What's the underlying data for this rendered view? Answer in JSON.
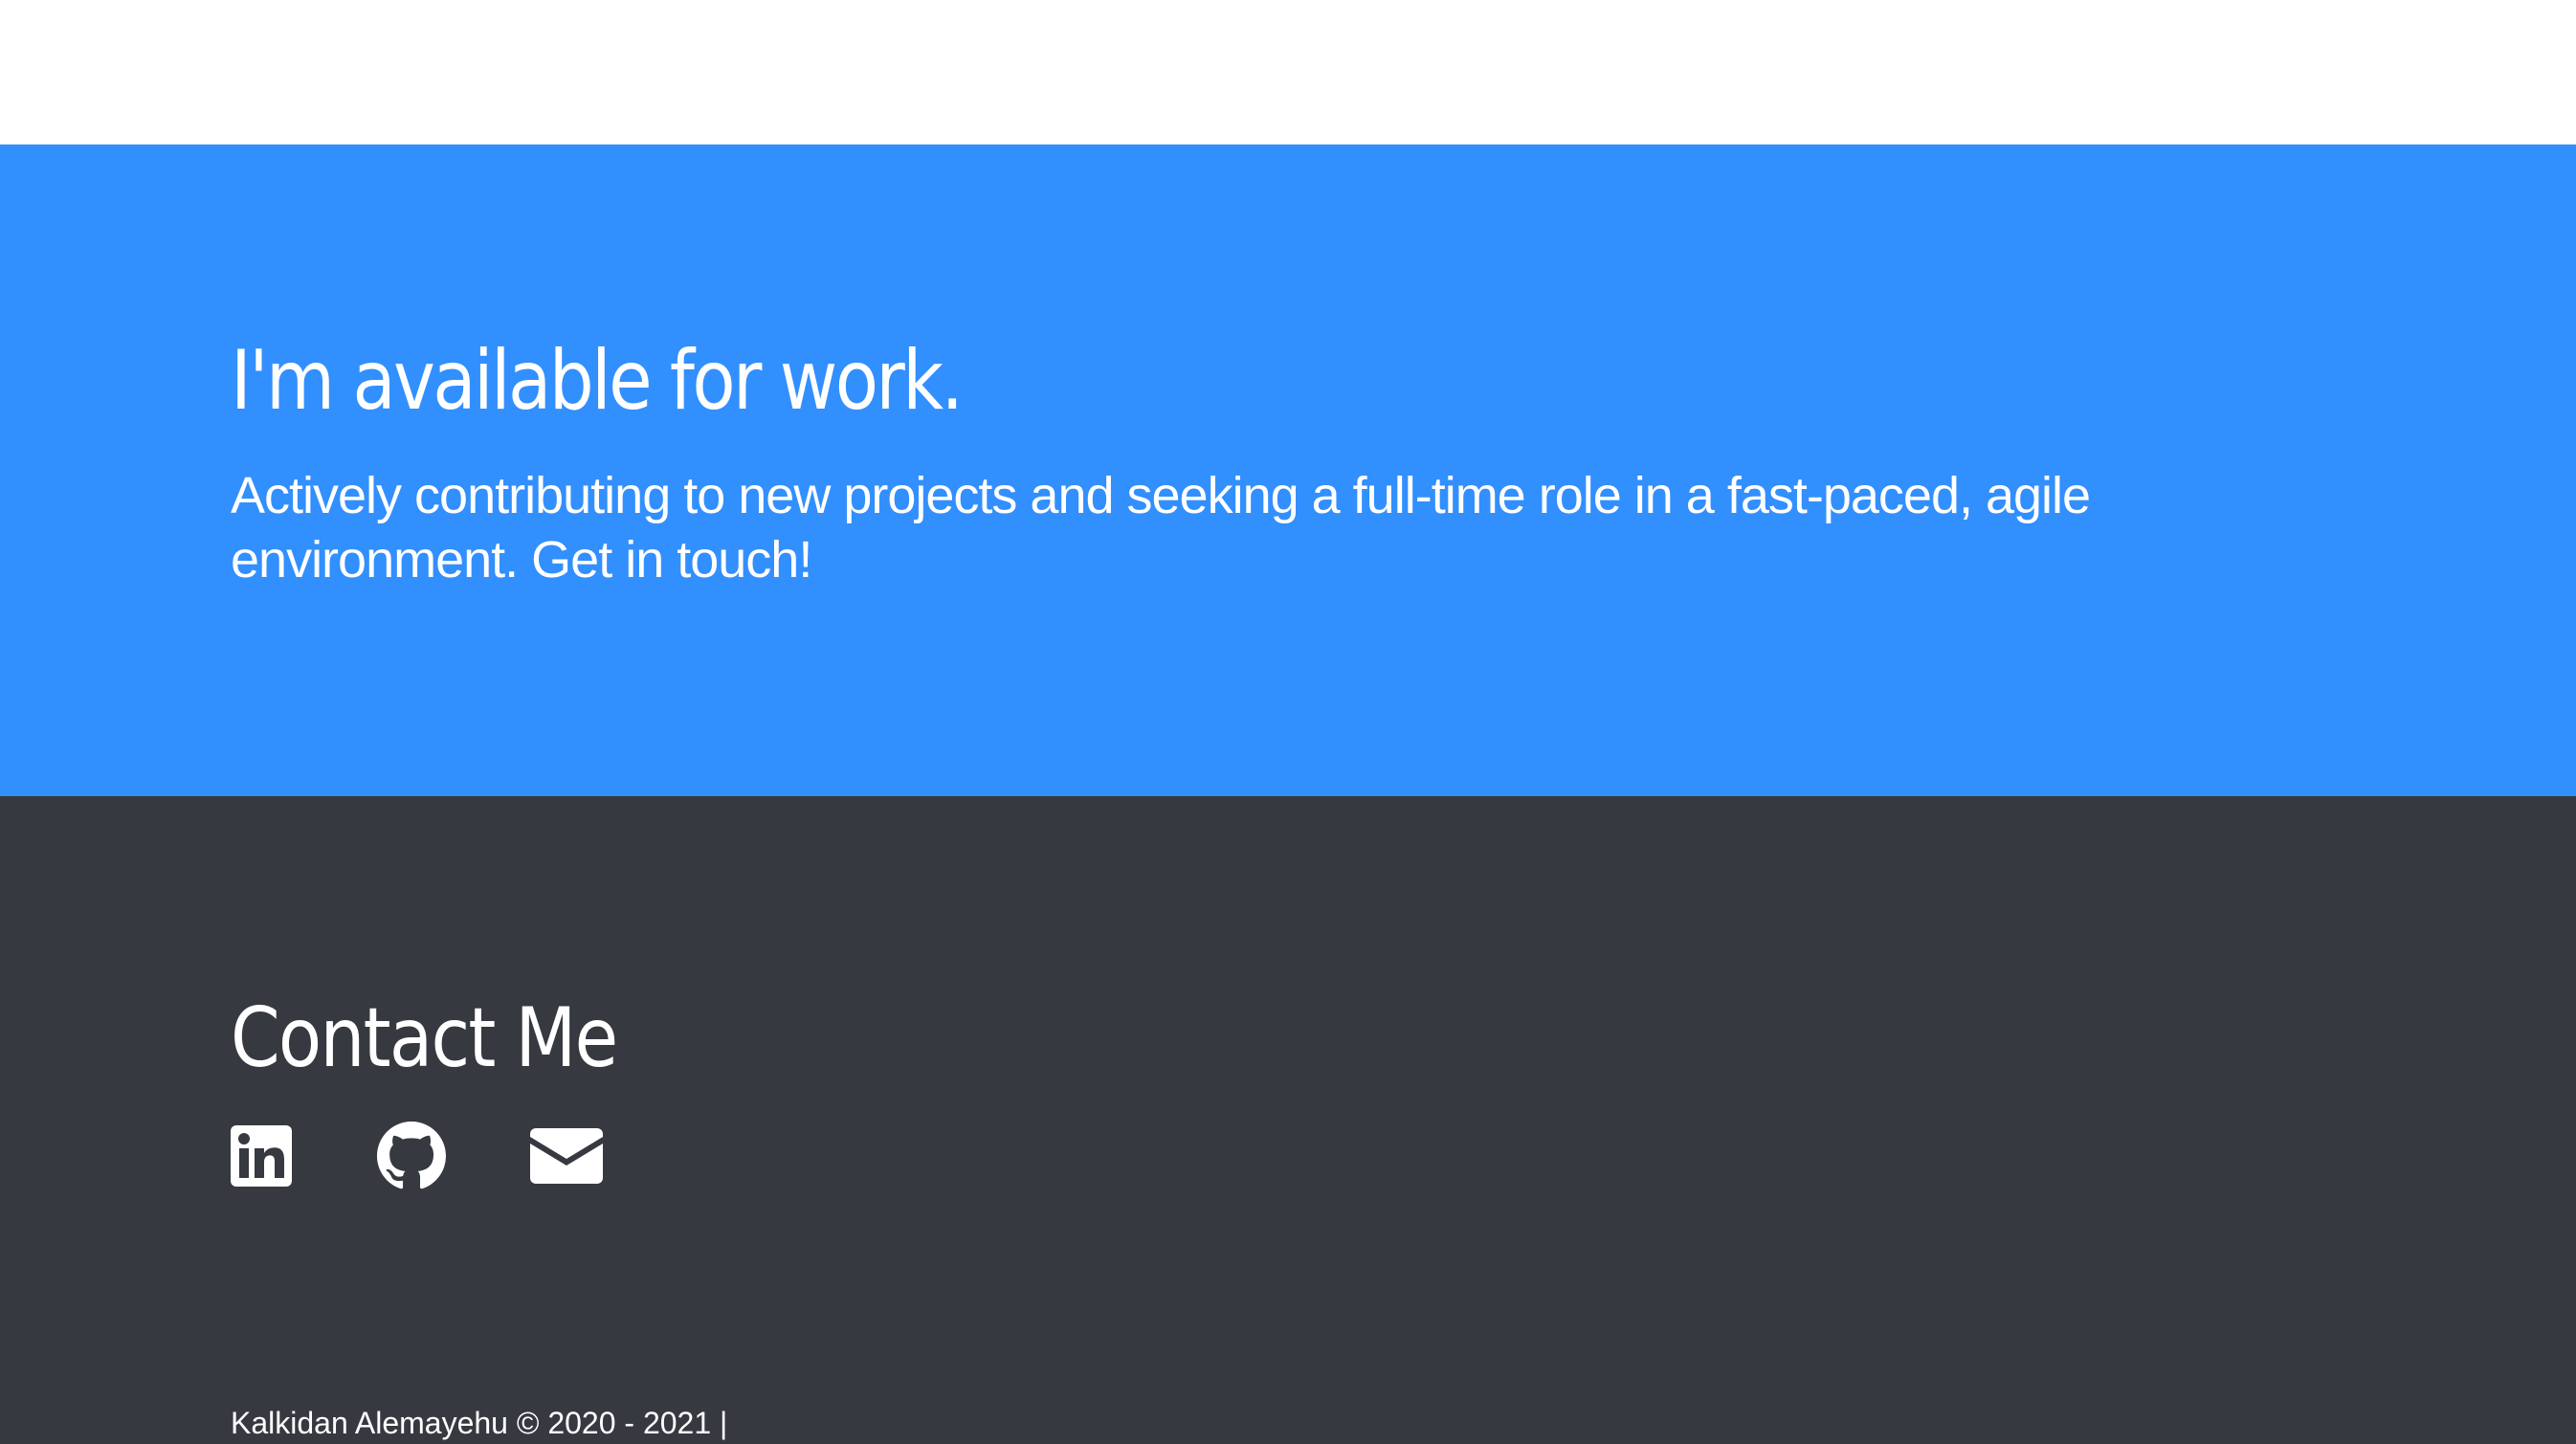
{
  "hero": {
    "title": "I'm available for work.",
    "text": "Actively contributing to new projects and seeking a full-time role in a fast-paced, agile environment. Get in touch!"
  },
  "contact": {
    "title": "Contact Me",
    "links": [
      {
        "icon": "linkedin-icon"
      },
      {
        "icon": "github-icon"
      },
      {
        "icon": "mail-icon"
      }
    ]
  },
  "footer": {
    "copyright": "Kalkidan Alemayehu © 2020 - 2021 |"
  },
  "colors": {
    "hero_background": "#328ffe",
    "contact_background": "#363940",
    "text": "#ffffff"
  }
}
